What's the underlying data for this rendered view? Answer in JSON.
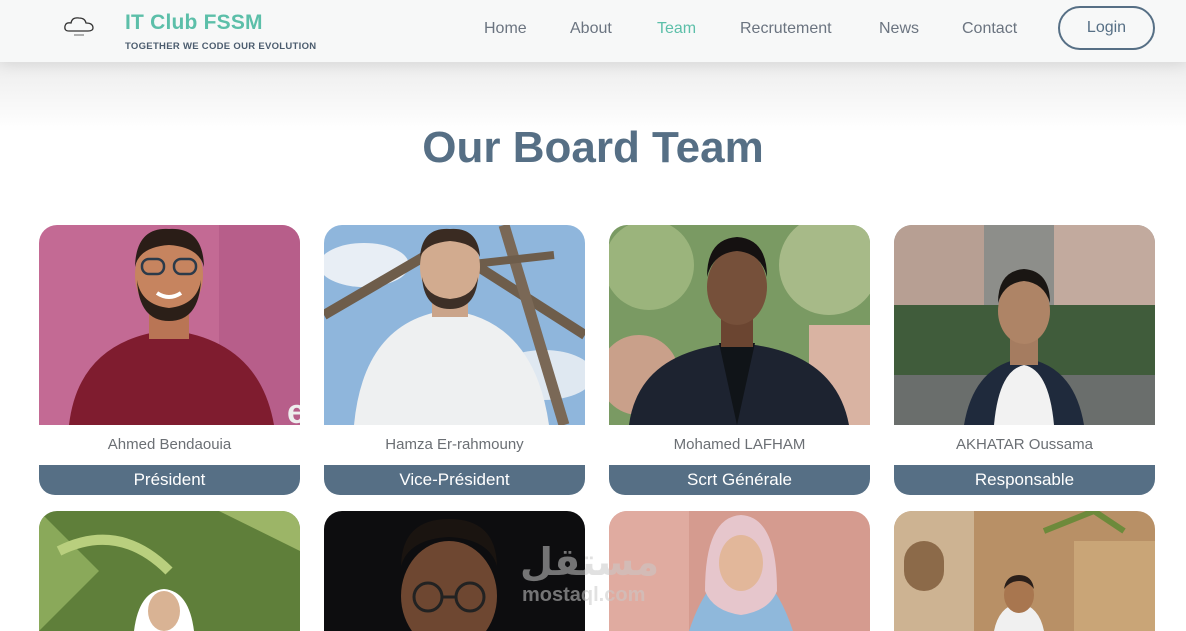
{
  "brand": {
    "title": "IT Club FSSM",
    "tagline": "TOGETHER WE CODE OUR EVOLUTION",
    "logo_icon": "cloud-logo-icon",
    "accent_color": "#5cbfa9",
    "primary_color": "#566f85"
  },
  "nav": {
    "items": [
      {
        "label": "Home",
        "active": false
      },
      {
        "label": "About",
        "active": false
      },
      {
        "label": "Team",
        "active": true
      },
      {
        "label": "Recrutement",
        "active": false
      },
      {
        "label": "News",
        "active": false
      },
      {
        "label": "Contact",
        "active": false
      }
    ],
    "login_label": "Login"
  },
  "section": {
    "title": "Our Board Team"
  },
  "members": [
    {
      "name": "Ahmed Bendaouia",
      "role": "Président"
    },
    {
      "name": "Hamza Er-rahmouny",
      "role": "Vice-Président"
    },
    {
      "name": "Mohamed LAFHAM",
      "role": "Scrt Générale"
    },
    {
      "name": "AKHATAR Oussama",
      "role": "Responsable"
    }
  ],
  "watermark": {
    "arabic": "مستقل",
    "latin": "mostaql.com"
  }
}
